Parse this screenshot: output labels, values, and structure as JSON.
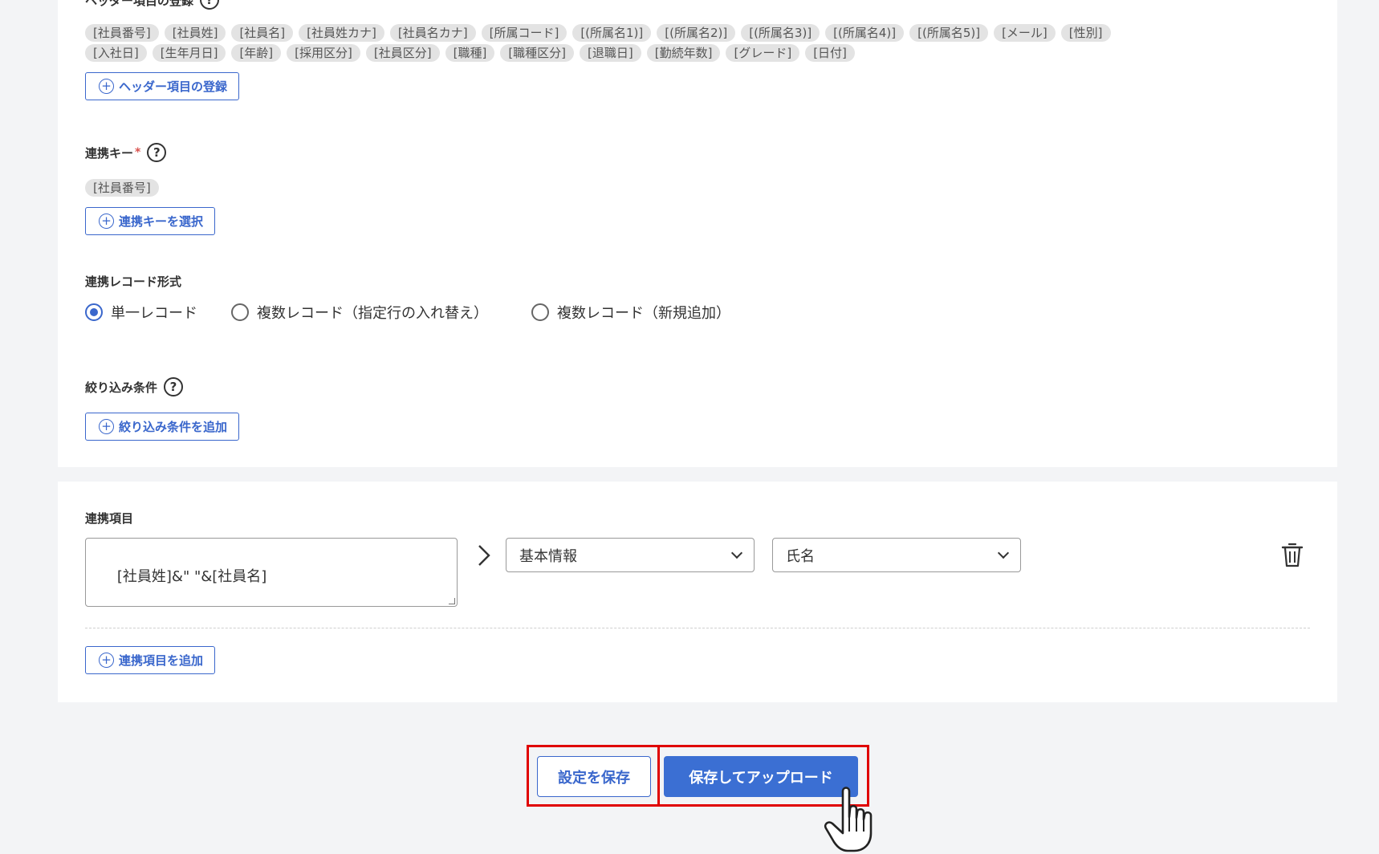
{
  "header_section": {
    "label": "ヘッダー項目の登録",
    "chips_row1": [
      "[社員番号]",
      "[社員姓]",
      "[社員名]",
      "[社員姓カナ]",
      "[社員名カナ]",
      "[所属コード]",
      "[(所属名1)]",
      "[(所属名2)]",
      "[(所属名3)]",
      "[(所属名4)]",
      "[(所属名5)]",
      "[メール]",
      "[性別]"
    ],
    "chips_row2": [
      "[入社日]",
      "[生年月日]",
      "[年齢]",
      "[採用区分]",
      "[社員区分]",
      "[職種]",
      "[職種区分]",
      "[退職日]",
      "[勤続年数]",
      "[グレード]",
      "[日付]"
    ],
    "register_button": "ヘッダー項目の登録"
  },
  "link_key": {
    "label": "連携キー",
    "required_mark": "*",
    "chips": [
      "[社員番号]"
    ],
    "select_button": "連携キーを選択"
  },
  "record_format": {
    "label": "連携レコード形式",
    "options": [
      {
        "label": "単一レコード",
        "selected": true
      },
      {
        "label": "複数レコード（指定行の入れ替え）",
        "selected": false
      },
      {
        "label": "複数レコード（新規追加）",
        "selected": false
      }
    ]
  },
  "filter": {
    "label": "絞り込み条件",
    "add_button": "絞り込み条件を追加"
  },
  "link_items": {
    "label": "連携項目",
    "expression": "[社員姓]&\" \"&[社員名]",
    "category_select": "基本情報",
    "field_select": "氏名",
    "add_button": "連携項目を追加"
  },
  "footer": {
    "save_settings": "設定を保存",
    "save_and_upload": "保存してアップロード"
  },
  "colors": {
    "accent": "#3b6fd3",
    "highlight": "#e00000",
    "chip_bg": "#e3e3e3",
    "page_bg": "#f3f4f6"
  }
}
